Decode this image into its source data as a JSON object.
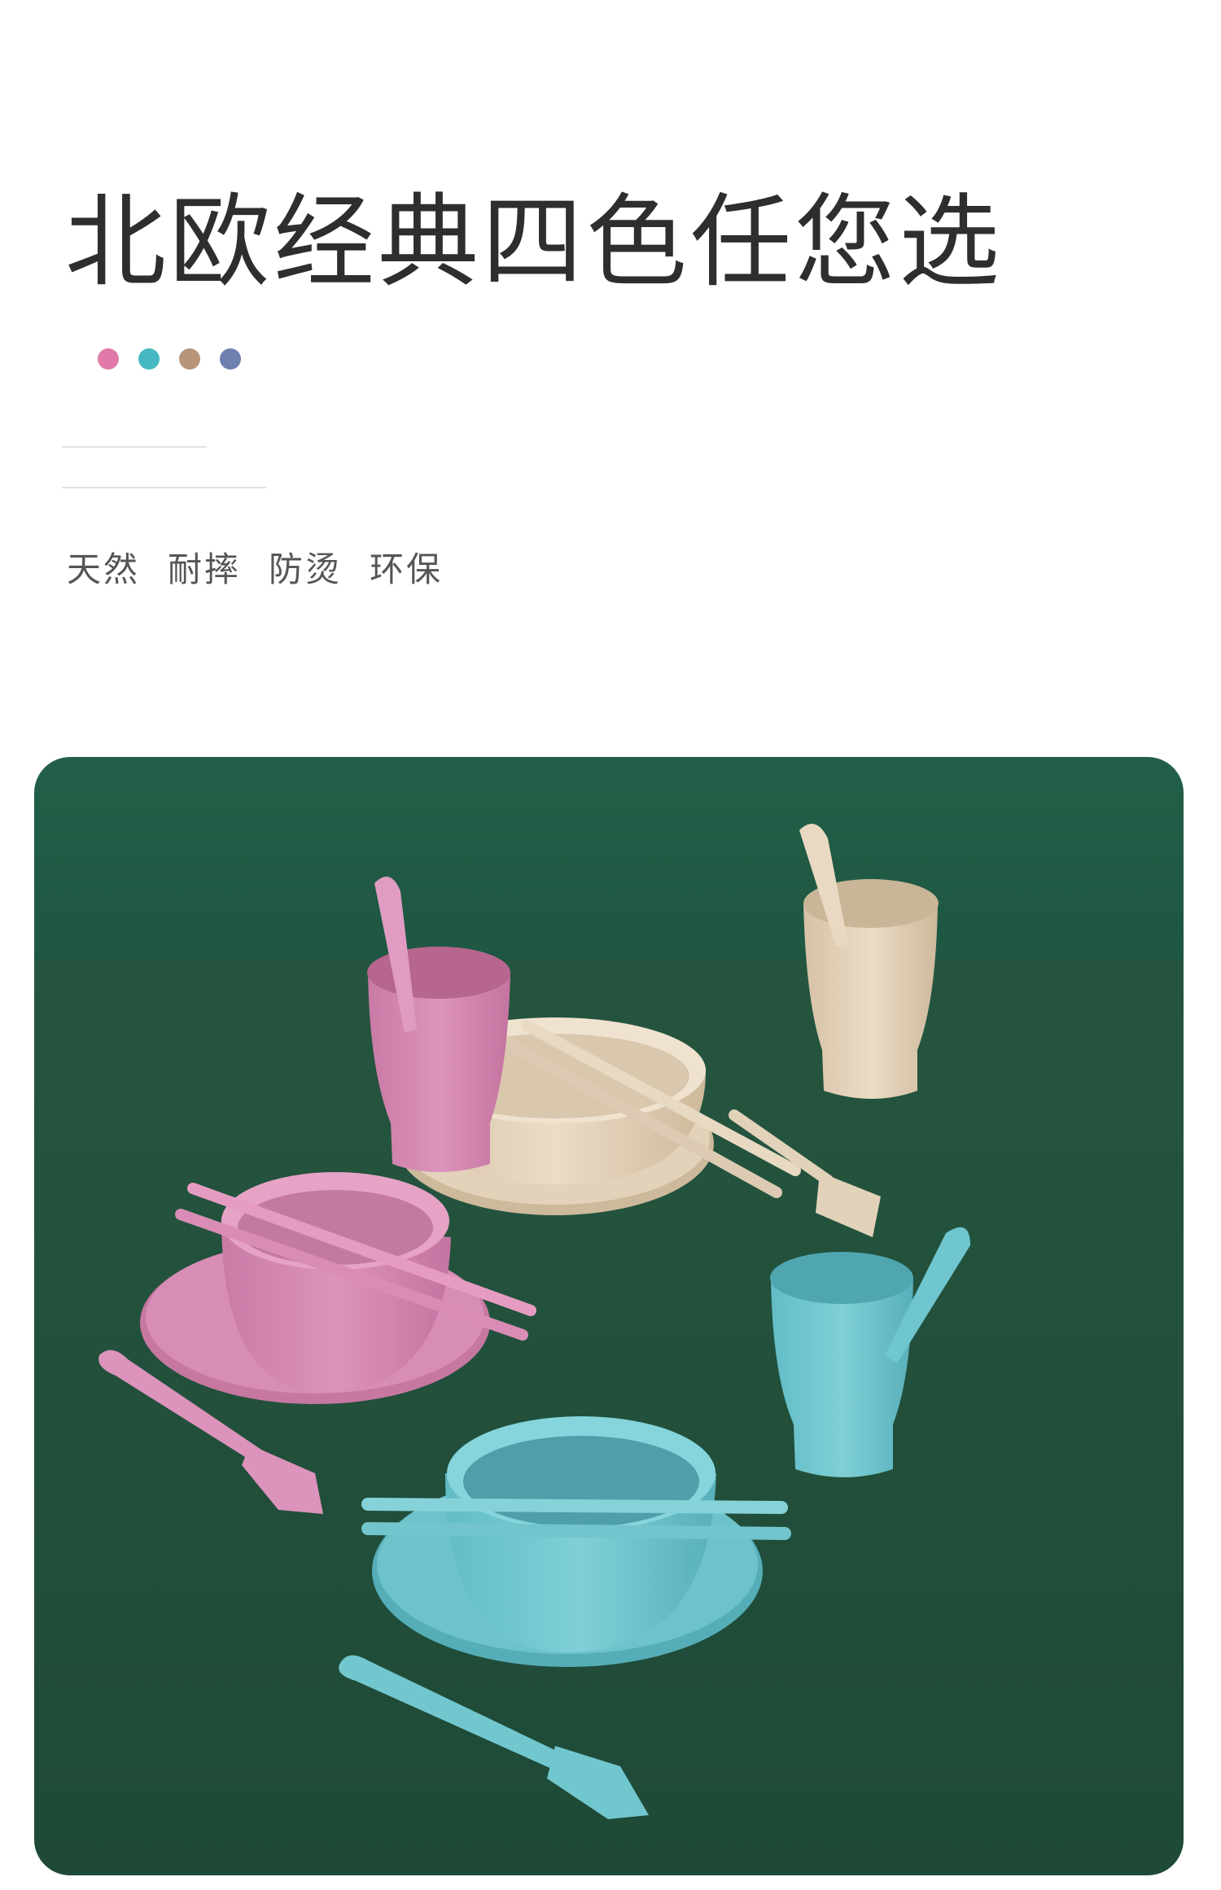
{
  "title": "北欧经典四色任您选",
  "color_options": [
    {
      "name": "pink",
      "hex": "#e17aa8"
    },
    {
      "name": "teal",
      "hex": "#45b8c2"
    },
    {
      "name": "wheat",
      "hex": "#b89478"
    },
    {
      "name": "blue",
      "hex": "#6e7fb0"
    }
  ],
  "features": [
    "天然",
    "耐摔",
    "防烫",
    "环保"
  ],
  "colors": {
    "background": "#ffffff",
    "photo_bg_top": "#1f5c46",
    "photo_bg_table": "#22513e",
    "pink": "#d88cb4",
    "teal": "#6cc3cc",
    "beige": "#e0d0b8"
  }
}
